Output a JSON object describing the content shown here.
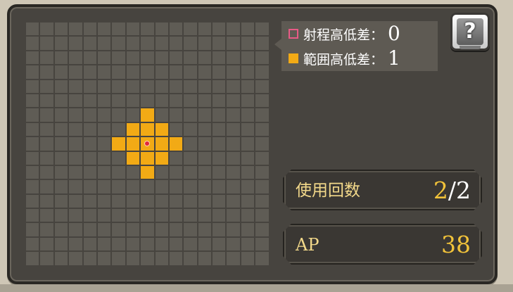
{
  "grid": {
    "columns": 17,
    "rows": 17,
    "center": [
      8,
      8
    ],
    "active_cells": [
      [
        8,
        6
      ],
      [
        7,
        7
      ],
      [
        8,
        7
      ],
      [
        9,
        7
      ],
      [
        6,
        8
      ],
      [
        7,
        8
      ],
      [
        8,
        8
      ],
      [
        9,
        8
      ],
      [
        10,
        8
      ],
      [
        7,
        9
      ],
      [
        8,
        9
      ],
      [
        9,
        9
      ],
      [
        8,
        10
      ]
    ],
    "colors": {
      "empty": "#5f5c55",
      "active": "#f2aa15",
      "center_marker": "#e0283a"
    }
  },
  "legend": {
    "range_label": "射程高低差：",
    "range_value": "0",
    "area_label": "範囲高低差：",
    "area_value": "1",
    "range_color": "#e85a86",
    "area_color": "#f2aa15"
  },
  "help_button": {
    "label": "?",
    "icon": "help-book-icon"
  },
  "usage": {
    "label": "使用回数",
    "current": "2",
    "slash": "/",
    "max": "2"
  },
  "ap": {
    "label": "AP",
    "value": "38"
  }
}
